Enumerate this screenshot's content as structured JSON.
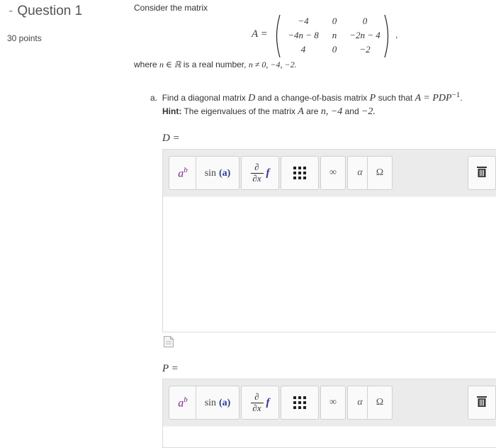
{
  "question": {
    "dash": "-",
    "title": "Question 1",
    "points": "30 points"
  },
  "intro": "Consider the matrix",
  "matrix": {
    "lhs": "A =",
    "rows": [
      [
        "−4",
        "0",
        "0"
      ],
      [
        "−4n − 8",
        "n",
        "−2n − 4"
      ],
      [
        "4",
        "0",
        "−2"
      ]
    ],
    "trailing": ","
  },
  "where": {
    "text_start": "where",
    "n_in_R": "n ∈ ℝ",
    "text_mid": "is a real number,",
    "condition": "n ≠ 0, −4, −2."
  },
  "part_a": {
    "marker": "a.",
    "text": "Find a diagonal matrix",
    "D": "D",
    "text2": "and a change-of-basis matrix",
    "P": "P",
    "text3": "such that",
    "eq": "A = PDP",
    "exp": "−1",
    "period": "."
  },
  "hint": {
    "label": "Hint:",
    "text": "The eigenvalues of the matrix",
    "A": "A",
    "text2": "are",
    "vals": "n, −4",
    "and": "and",
    "last": "−2."
  },
  "fields": [
    {
      "label": "D =",
      "toolbar": {
        "power_base": "a",
        "power_exp": "b",
        "sin_fn": "sin",
        "sin_arg": "(a)",
        "deriv_num": "∂",
        "deriv_den": "∂x",
        "deriv_f": "f",
        "infinity": "∞",
        "alpha": "α",
        "omega": "Ω"
      }
    },
    {
      "label": "P =",
      "toolbar": {
        "power_base": "a",
        "power_exp": "b",
        "sin_fn": "sin",
        "sin_arg": "(a)",
        "deriv_num": "∂",
        "deriv_den": "∂x",
        "deriv_f": "f",
        "infinity": "∞",
        "alpha": "α",
        "omega": "Ω"
      }
    }
  ],
  "colors": {
    "power_icon": "#7a2a8a",
    "sin_arg": "#2a3a9a",
    "f_icon": "#3a2a9a",
    "toolbar_bg": "#ebebeb"
  }
}
